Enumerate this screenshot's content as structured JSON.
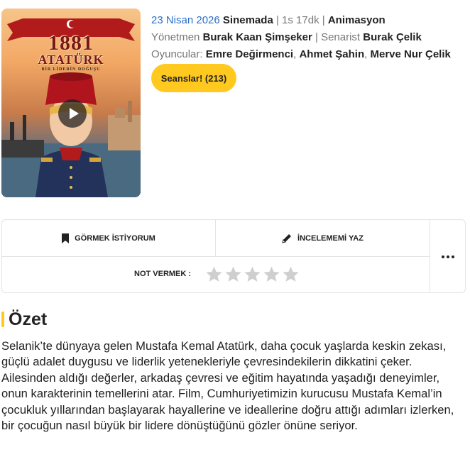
{
  "poster": {
    "year_text": "1881",
    "name_text": "ATATÜRK",
    "tagline_text": "BİR LİDERİN DOĞUŞU"
  },
  "info": {
    "date": "23 Nisan 2026",
    "status": "Sinemada",
    "sep": "|",
    "duration": "1s 17dk",
    "genre": "Animasyon",
    "director_label": "Yönetmen",
    "director": "Burak Kaan Şimşeker",
    "writer_label": "Senarist",
    "writer": "Burak Çelik",
    "cast_label": "Oyuncular:",
    "cast": [
      "Emre Değirmenci",
      "Ahmet Şahin",
      "Merve Nur Çelik"
    ],
    "cast_sep": ","
  },
  "sessions_button": "Seanslar! (213)",
  "actions": {
    "want_label": "GÖRMEK İSTİYORUM",
    "review_label": "İNCELEMEMİ YAZ",
    "rate_label": "NOT VERMEK :",
    "stars": 5
  },
  "summary": {
    "title": "Özet",
    "text": "Selanik’te dünyaya gelen Mustafa Kemal Atatürk, daha çocuk yaşlarda keskin zekası, güçlü adalet duygusu ve liderlik yetenekleriyle çevresindekilerin dikkatini çeker. Ailesinden aldığı değerler, arkadaş çevresi ve eğitim hayatında yaşadığı deneyimler, onun karakterinin temellerini atar. Film, Cumhuriyetimizin kurucusu Mustafa Kemal’in çocukluk yıllarından başlayarak hayallerine ve ideallerine doğru attığı adımları izlerken, bir çocuğun nasıl büyük bir lidere dönüştüğünü gözler önüne seriyor."
  },
  "colors": {
    "accent": "#ffc91f",
    "date_blue": "#2a6fc9",
    "star_gray": "#cfcfcf"
  }
}
